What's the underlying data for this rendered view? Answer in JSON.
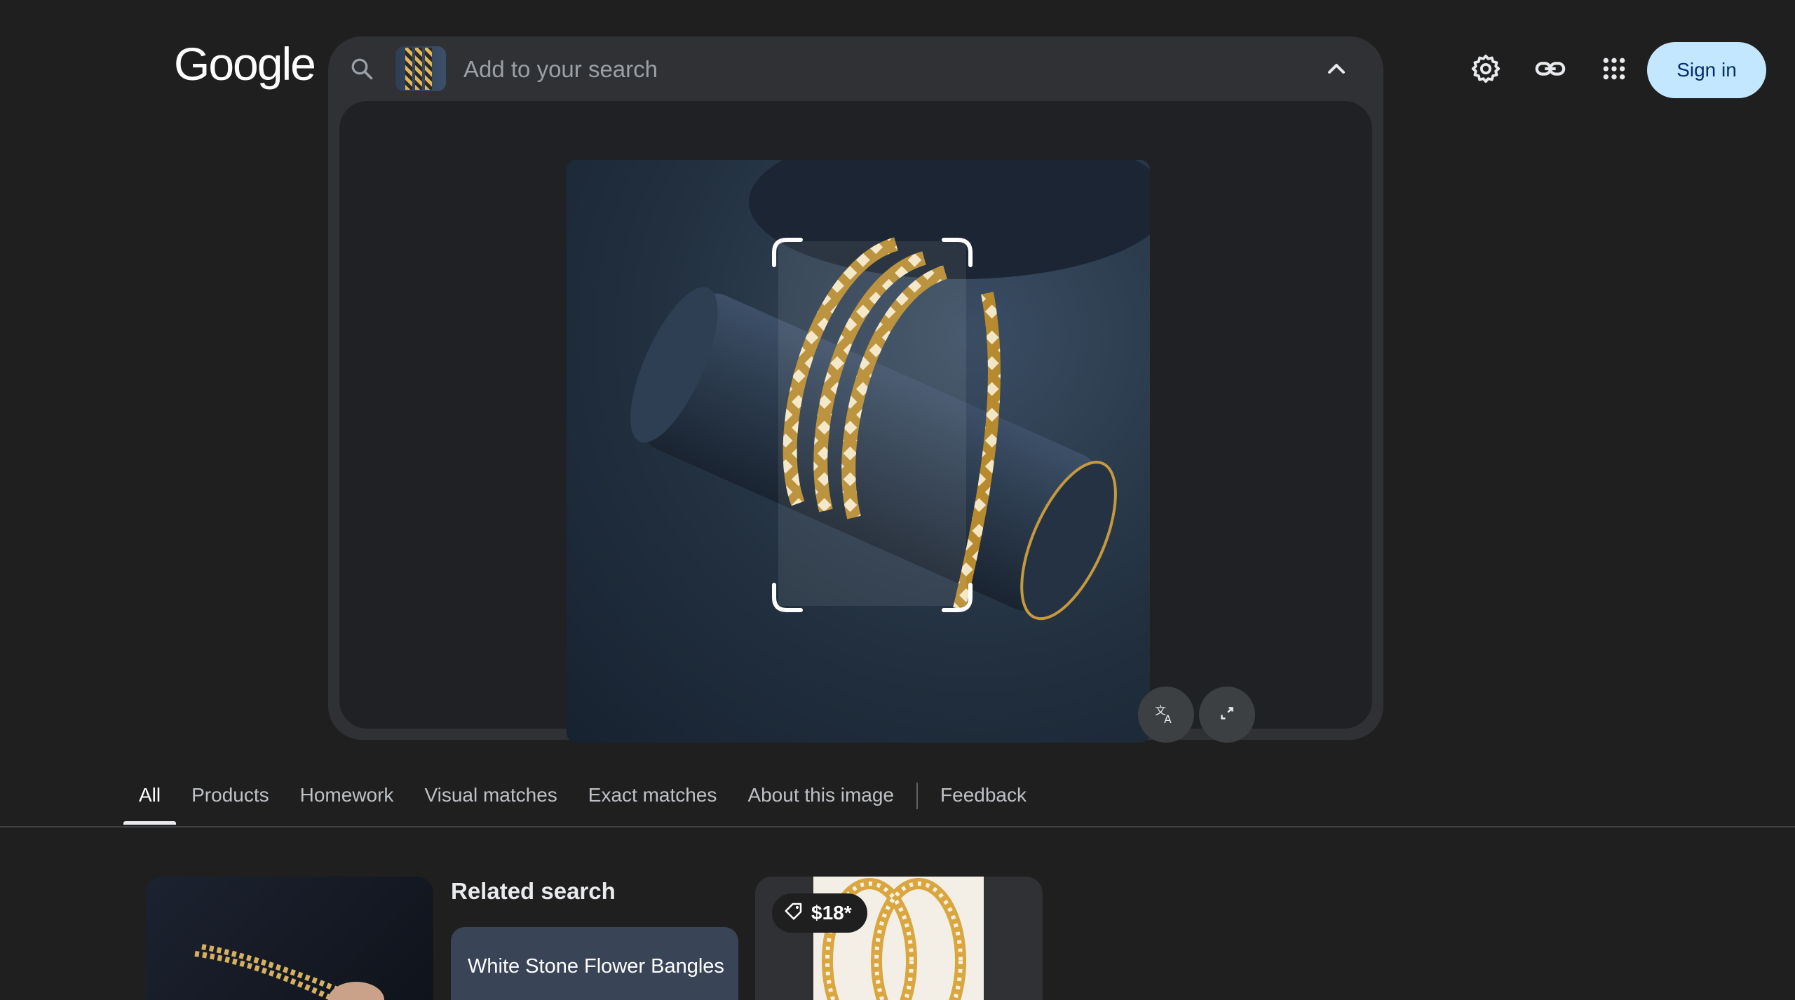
{
  "header": {
    "logo_text": "Google",
    "sign_in_label": "Sign in",
    "icons": [
      "settings-icon",
      "link-icon",
      "apps-icon"
    ]
  },
  "search": {
    "placeholder": "Add to your search",
    "value": ""
  },
  "lens": {
    "buttons": [
      "translate-icon",
      "expand-icon"
    ]
  },
  "tabs": [
    {
      "label": "All",
      "active": true
    },
    {
      "label": "Products"
    },
    {
      "label": "Homework"
    },
    {
      "label": "Visual matches"
    },
    {
      "label": "Exact matches"
    },
    {
      "label": "About this image"
    },
    {
      "label": "Feedback"
    }
  ],
  "results": {
    "related_title": "Related search",
    "related_chip": "White Stone Flower Bangles",
    "product_price": "$18*"
  },
  "colors": {
    "background": "#1f1f1f",
    "search_box": "#303134",
    "sign_in_bg": "#c2e7ff",
    "related_chip_bg": "#394457",
    "gold": "#d9a640"
  }
}
